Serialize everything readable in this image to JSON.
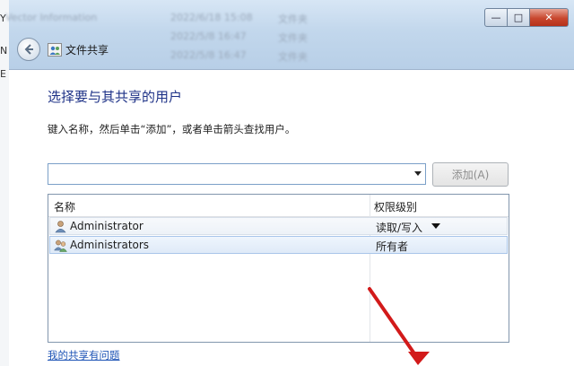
{
  "background_window": {
    "left_edge_chars": [
      "Y",
      "N",
      "E"
    ],
    "ghost_rows": [
      {
        "col1": "Vector Information",
        "col2": "2022/6/18 15:08",
        "col3": "文件夹"
      },
      {
        "col1": "",
        "col2": "2022/5/8 16:47",
        "col3": "文件夹"
      },
      {
        "col1": "",
        "col2": "2022/5/8 16:47",
        "col3": "文件夹"
      }
    ]
  },
  "titlebar": {
    "title": "文件共享",
    "icons": {
      "back": "back-arrow-icon",
      "app": "file-share-icon"
    },
    "buttons": {
      "minimize": "—",
      "maximize": "□",
      "close": "✕"
    }
  },
  "content": {
    "heading": "选择要与其共享的用户",
    "instructions": "键入名称，然后单击“添加”，或者单击箭头查找用户。",
    "name_input": {
      "value": "",
      "placeholder": ""
    },
    "add_button": "添加(A)"
  },
  "user_list": {
    "columns": [
      "名称",
      "权限级别"
    ],
    "rows": [
      {
        "name": "Administrator",
        "permission": "读取/写入",
        "icon": "user-icon",
        "has_dropdown": true
      },
      {
        "name": "Administrators",
        "permission": "所有者",
        "icon": "user-group-icon",
        "has_dropdown": false
      }
    ]
  },
  "help_link": "我的共享有问题",
  "colors": {
    "heading": "#1e3287",
    "link": "#1f55b6",
    "annotation_arrow": "#d21a1a"
  }
}
